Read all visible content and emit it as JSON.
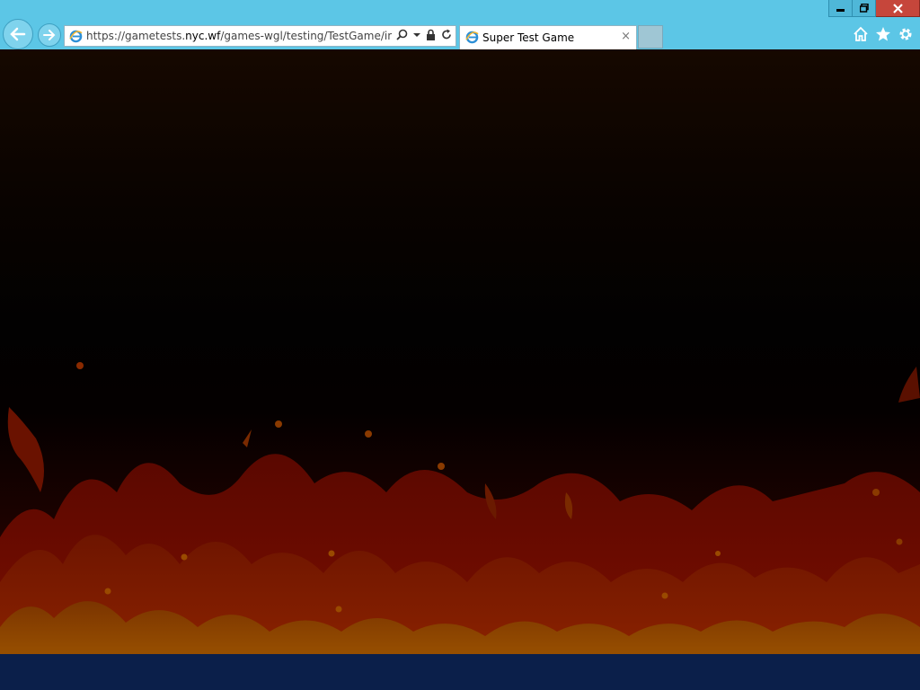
{
  "browser": {
    "address_url_prefix": "https://gametests.",
    "address_url_domain": "nyc.wf",
    "address_url_path": "/games-wgl/testing/TestGame/index.ht",
    "tab_title": "Super Test Game",
    "tab_close_glyph": "×"
  },
  "icons": {
    "back": "back-arrow-icon",
    "forward": "forward-arrow-icon",
    "site": "ie-site-icon",
    "search": "search-icon",
    "dropdown": "chevron-down-icon",
    "lock": "lock-icon",
    "refresh": "refresh-icon",
    "home": "home-icon",
    "favorites": "star-icon",
    "settings": "gear-icon",
    "minimize": "minimize-icon",
    "restore": "restore-icon",
    "close": "close-icon"
  },
  "colors": {
    "chrome": "#5cc6e6",
    "close_button": "#c6463b",
    "footer": "#0b1f4a"
  }
}
